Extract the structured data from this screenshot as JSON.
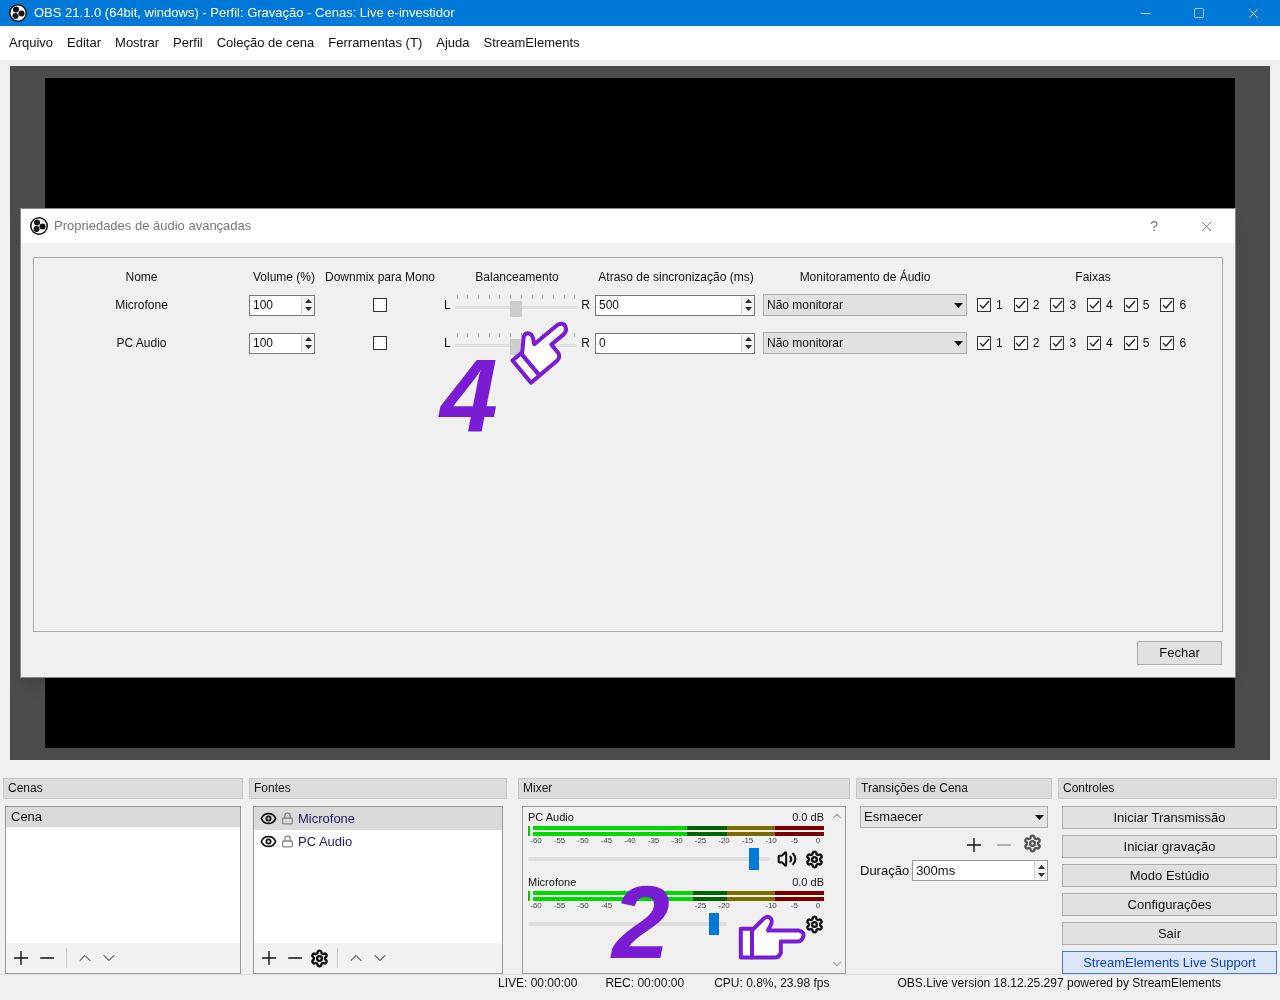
{
  "window": {
    "title": "OBS 21.1.0 (64bit, windows) - Perfil: Gravação - Cenas: Live e-investidor"
  },
  "menu": [
    "Arquivo",
    "Editar",
    "Mostrar",
    "Perfil",
    "Coleção de cena",
    "Ferramentas (T)",
    "Ajuda",
    "StreamElements"
  ],
  "dialog": {
    "title": "Propriedades de áudio avançadas",
    "help": "?",
    "columns": [
      "Nome",
      "Volume (%)",
      "Downmix para Mono",
      "Balanceamento",
      "Atraso de sincronização (ms)",
      "Monitoramento de Áudio",
      "Faixas"
    ],
    "rows": [
      {
        "name": "Microfone",
        "volume": "100",
        "downmix": false,
        "balance": {
          "left": "L",
          "right": "R",
          "level": 0.5
        },
        "delay": "500",
        "monitoring": "Não monitorar",
        "tracks": [
          {
            "label": "1",
            "checked": true
          },
          {
            "label": "2",
            "checked": true
          },
          {
            "label": "3",
            "checked": true
          },
          {
            "label": "4",
            "checked": true
          },
          {
            "label": "5",
            "checked": true
          },
          {
            "label": "6",
            "checked": true
          }
        ]
      },
      {
        "name": "PC Audio",
        "volume": "100",
        "downmix": false,
        "balance": {
          "left": "L",
          "right": "R",
          "level": 0.5
        },
        "delay": "0",
        "monitoring": "Não monitorar",
        "tracks": [
          {
            "label": "1",
            "checked": true
          },
          {
            "label": "2",
            "checked": true
          },
          {
            "label": "3",
            "checked": true
          },
          {
            "label": "4",
            "checked": true
          },
          {
            "label": "5",
            "checked": true
          },
          {
            "label": "6",
            "checked": true
          }
        ]
      }
    ],
    "close_button": "Fechar"
  },
  "scenes": {
    "title": "Cenas",
    "items": [
      {
        "label": "Cena",
        "selected": true
      }
    ]
  },
  "sources": {
    "title": "Fontes",
    "items": [
      {
        "label": "Microfone",
        "selected": true
      },
      {
        "label": "PC Audio",
        "selected": false
      }
    ]
  },
  "mixer": {
    "title": "Mixer",
    "channels": [
      {
        "name": "PC Audio",
        "reading": "0.0 dB",
        "meter": {
          "level": 0.53
        },
        "fader": {
          "level": 0.96
        },
        "scale": [
          {
            "kind": "label",
            "text": "-60"
          },
          {
            "kind": "label",
            "text": "-55"
          },
          {
            "kind": "label",
            "text": "-50"
          },
          {
            "kind": "label",
            "text": "-45"
          },
          {
            "kind": "label",
            "text": "-40"
          },
          {
            "kind": "label",
            "text": "-35"
          },
          {
            "kind": "label",
            "text": "-30"
          },
          {
            "kind": "label",
            "text": "-25"
          },
          {
            "kind": "label",
            "text": "-20"
          },
          {
            "kind": "label",
            "text": "-15"
          },
          {
            "kind": "label",
            "text": "-10"
          },
          {
            "kind": "label",
            "text": "-5"
          },
          {
            "kind": "label",
            "text": "0"
          }
        ]
      },
      {
        "name": "Microfone",
        "reading": "0.0 dB",
        "meter": {
          "level": 0.55
        },
        "fader": {
          "level": 0.96
        },
        "scale": [
          {
            "kind": "label",
            "text": "-60"
          },
          {
            "kind": "label",
            "text": "-55"
          },
          {
            "kind": "label",
            "text": "-50"
          },
          {
            "kind": "label",
            "text": "-45"
          },
          {
            "kind": "covered"
          },
          {
            "kind": "covered"
          },
          {
            "kind": "covered"
          },
          {
            "kind": "label",
            "text": "-25"
          },
          {
            "kind": "label",
            "text": "-20"
          },
          {
            "kind": "covered"
          },
          {
            "kind": "label",
            "text": "-10"
          },
          {
            "kind": "label",
            "text": "-5"
          },
          {
            "kind": "label",
            "text": "0"
          }
        ]
      }
    ]
  },
  "transitions": {
    "title": "Transições de Cena",
    "selected": "Esmaecer",
    "duration_label": "Duração",
    "duration": "300ms"
  },
  "controls": {
    "title": "Controles",
    "buttons": [
      {
        "label": "Iniciar Transmissão",
        "focused": false
      },
      {
        "label": "Iniciar gravação",
        "focused": false
      },
      {
        "label": "Modo Estúdio",
        "focused": false
      },
      {
        "label": "Configurações",
        "focused": false
      },
      {
        "label": "Sair",
        "focused": false
      },
      {
        "label": "StreamElements Live Support",
        "focused": true
      }
    ]
  },
  "status_bar": [
    "LIVE: 00:00:00",
    "REC: 00:00:00",
    "CPU: 0.8%, 23.98 fps",
    "OBS.Live version 18.12.25.297 powered by StreamElements"
  ],
  "annotations": [
    {
      "number": "4"
    },
    {
      "number": "2"
    }
  ]
}
